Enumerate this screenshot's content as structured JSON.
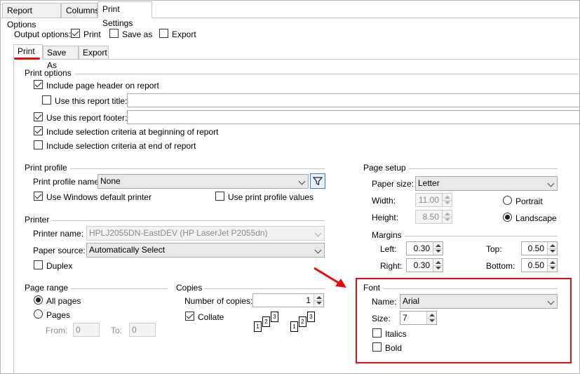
{
  "tabs": [
    "Report Options",
    "Columns",
    "Print Settings"
  ],
  "output_options": {
    "label": "Output options:",
    "print": {
      "label": "Print",
      "checked": true
    },
    "save_as": {
      "label": "Save as",
      "checked": false
    },
    "export": {
      "label": "Export",
      "checked": false
    }
  },
  "inner_tabs": [
    "Print",
    "Save As",
    "Export"
  ],
  "print_options": {
    "title": "Print options",
    "include_header": {
      "label": "Include page header on report",
      "checked": true
    },
    "use_report_title": {
      "label": "Use this report title:",
      "checked": false,
      "value": ""
    },
    "use_footer": {
      "label": "Use this report footer:",
      "checked": true,
      "value": ""
    },
    "criteria_begin": {
      "label": "Include selection criteria at beginning of report",
      "checked": true
    },
    "criteria_end": {
      "label": "Include selection criteria at end of report",
      "checked": false
    }
  },
  "print_profile": {
    "title": "Print profile",
    "name_label": "Print profile name:",
    "name_value": "None",
    "use_windows_default": {
      "label": "Use Windows default printer",
      "checked": true
    },
    "use_profile_values": {
      "label": "Use print profile values",
      "checked": false
    }
  },
  "printer": {
    "title": "Printer",
    "name_label": "Printer name:",
    "name_value": "HPLJ2055DN-EastDEV (HP LaserJet P2055dn)",
    "source_label": "Paper source:",
    "source_value": "Automatically Select",
    "duplex": {
      "label": "Duplex",
      "checked": false
    }
  },
  "page_range": {
    "title": "Page range",
    "all_pages": {
      "label": "All pages",
      "checked": true
    },
    "pages": {
      "label": "Pages",
      "checked": false
    },
    "from_label": "From:",
    "from_value": "0",
    "to_label": "To:",
    "to_value": "0"
  },
  "copies": {
    "title": "Copies",
    "number_label": "Number of copies:",
    "number_value": "1",
    "collate": {
      "label": "Collate",
      "checked": true
    }
  },
  "page_setup": {
    "title": "Page setup",
    "paper_size_label": "Paper size:",
    "paper_size_value": "Letter",
    "width_label": "Width:",
    "width_value": "11.00",
    "height_label": "Height:",
    "height_value": "8.50",
    "portrait": {
      "label": "Portrait",
      "checked": false
    },
    "landscape": {
      "label": "Landscape",
      "checked": true
    }
  },
  "margins": {
    "title": "Margins",
    "left_label": "Left:",
    "left_value": "0.30",
    "top_label": "Top:",
    "top_value": "0.50",
    "right_label": "Right:",
    "right_value": "0.30",
    "bottom_label": "Bottom:",
    "bottom_value": "0.50"
  },
  "font": {
    "title": "Font",
    "name_label": "Name:",
    "name_value": "Arial",
    "size_label": "Size:",
    "size_value": "7",
    "italics": {
      "label": "Italics",
      "checked": false
    },
    "bold": {
      "label": "Bold",
      "checked": false
    }
  },
  "colors": {
    "annotation_red": "#e01010",
    "filter_blue": "#3c7fb1"
  }
}
